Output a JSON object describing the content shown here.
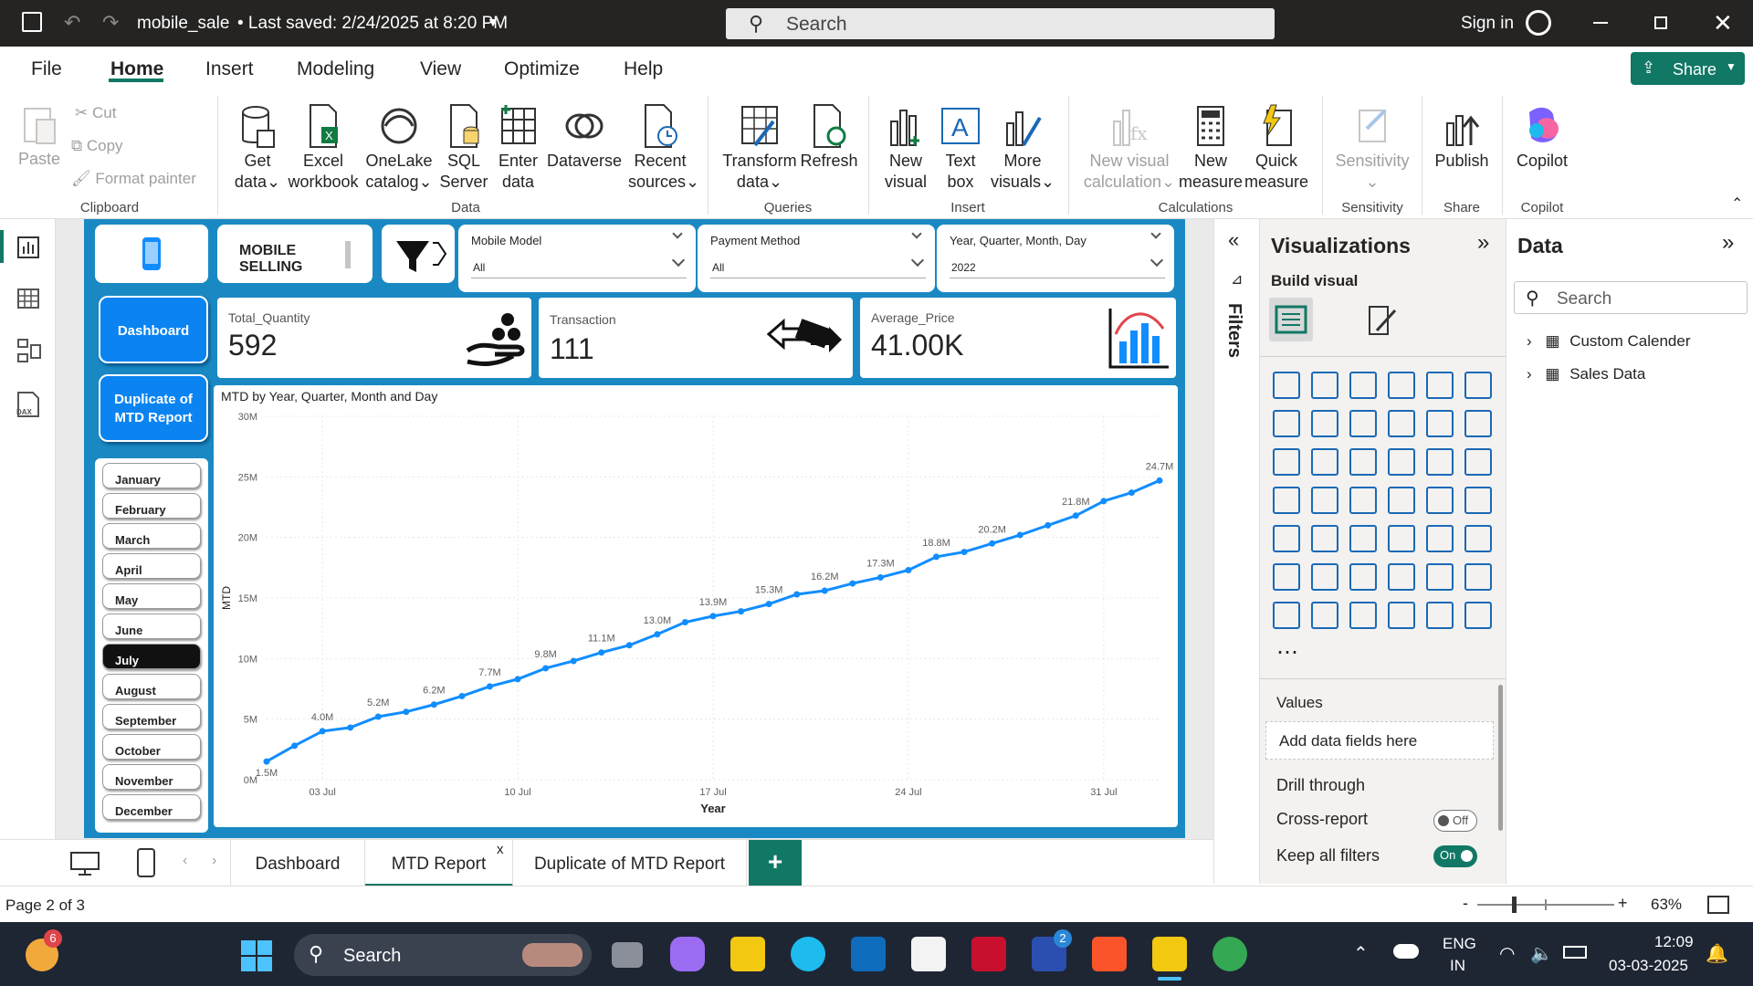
{
  "titlebar": {
    "file_name": "mobile_sale",
    "saved_status": "• Last saved: 2/24/2025 at 8:20 PM",
    "search_placeholder": "Search",
    "sign_in": "Sign in"
  },
  "menu": {
    "items": [
      "File",
      "Home",
      "Insert",
      "Modeling",
      "View",
      "Optimize",
      "Help"
    ],
    "share": "Share"
  },
  "ribbon": {
    "clipboard": {
      "paste": "Paste",
      "cut": "Cut",
      "copy": "Copy",
      "format_painter": "Format painter",
      "group": "Clipboard"
    },
    "data": {
      "get_data": [
        "Get",
        "data"
      ],
      "excel": [
        "Excel",
        "workbook"
      ],
      "onelake": [
        "OneLake",
        "catalog"
      ],
      "sql": [
        "SQL",
        "Server"
      ],
      "enter": [
        "Enter",
        "data"
      ],
      "dataverse": "Dataverse",
      "recent": [
        "Recent",
        "sources"
      ],
      "group": "Data"
    },
    "queries": {
      "transform": [
        "Transform",
        "data"
      ],
      "refresh": "Refresh",
      "group": "Queries"
    },
    "insert": {
      "new_visual": [
        "New",
        "visual"
      ],
      "text_box": [
        "Text",
        "box"
      ],
      "more_visuals": [
        "More",
        "visuals"
      ],
      "group": "Insert"
    },
    "calculations": {
      "new_visual_calc": [
        "New visual",
        "calculation"
      ],
      "new_measure": [
        "New",
        "measure"
      ],
      "quick_measure": [
        "Quick",
        "measure"
      ],
      "group": "Calculations"
    },
    "sensitivity": {
      "label": "Sensitivity",
      "group": "Sensitivity"
    },
    "share": {
      "publish": "Publish",
      "group": "Share"
    },
    "copilot": {
      "label": "Copilot",
      "group": "Copilot"
    }
  },
  "report": {
    "title_card": [
      "MOBILE",
      "SELLING"
    ],
    "slicers": [
      {
        "title": "Mobile Model",
        "value": "All"
      },
      {
        "title": "Payment Method",
        "value": "All"
      },
      {
        "title": "Year, Quarter, Month, Day",
        "value": "2022"
      }
    ],
    "nav_buttons": [
      "Dashboard",
      "Duplicate of MTD Report"
    ],
    "kpis": [
      {
        "label": "Total_Quantity",
        "value": "592"
      },
      {
        "label": "Transaction",
        "value": "111"
      },
      {
        "label": "Average_Price",
        "value": "41.00K"
      }
    ],
    "months": [
      "January",
      "February",
      "March",
      "April",
      "May",
      "June",
      "July",
      "August",
      "September",
      "October",
      "November",
      "December"
    ],
    "selected_month": "July"
  },
  "chart_data": {
    "type": "line",
    "title": "MTD by Year, Quarter, Month and Day",
    "xlabel": "Year",
    "ylabel": "MTD",
    "x_ticks": [
      "03 Jul",
      "10 Jul",
      "17 Jul",
      "24 Jul",
      "31 Jul"
    ],
    "y_ticks": [
      "0M",
      "5M",
      "10M",
      "15M",
      "20M",
      "25M",
      "30M"
    ],
    "ylim": [
      0,
      30
    ],
    "x": [
      1,
      2,
      3,
      4,
      5,
      6,
      7,
      8,
      9,
      10,
      11,
      12,
      13,
      14,
      15,
      16,
      17,
      18,
      19,
      20,
      21,
      22,
      23,
      24,
      25,
      26,
      27,
      28,
      29,
      30,
      31
    ],
    "values": [
      1.5,
      2.8,
      4.0,
      4.3,
      5.2,
      5.6,
      6.2,
      6.9,
      7.7,
      8.3,
      9.2,
      9.8,
      10.5,
      11.1,
      12.0,
      13.0,
      13.5,
      13.9,
      14.5,
      15.3,
      15.6,
      16.2,
      16.7,
      17.3,
      18.4,
      18.8,
      19.5,
      20.2,
      21.0,
      21.8,
      23.0,
      23.7,
      24.7
    ],
    "data_labels": {
      "1": "1.5M",
      "3": "4.0M",
      "5": "5.2M",
      "7": "6.2M",
      "9": "7.7M",
      "11": "9.8M",
      "13": "11.1M",
      "15": "13.0M",
      "17": "13.9M",
      "19": "15.3M",
      "21": "16.2M",
      "23": "17.3M",
      "25": "18.8M",
      "27": "20.2M",
      "29": "21.8M",
      "31": "24.7M"
    },
    "series": [
      {
        "values": [
          1.5,
          2.8,
          4.0,
          4.3,
          5.2,
          5.6,
          6.2,
          6.9,
          7.7,
          8.3,
          9.8,
          10.5,
          11.1,
          12.0,
          13.0,
          13.5,
          13.9,
          14.5,
          15.3,
          15.6,
          16.2,
          16.7,
          17.3,
          18.4,
          18.8,
          19.5,
          20.2,
          21.0,
          21.8,
          23.0,
          23.7,
          24.7
        ]
      }
    ],
    "grid": true,
    "color": "#118dff"
  },
  "filters_label": "Filters",
  "visualizations": {
    "title": "Visualizations",
    "build_visual": "Build visual",
    "values": "Values",
    "add_fields": "Add data fields here",
    "drill_through": "Drill through",
    "cross_report": "Cross-report",
    "cross_report_state": "Off",
    "keep_filters": "Keep all filters",
    "keep_filters_state": "On"
  },
  "data_pane": {
    "title": "Data",
    "search_placeholder": "Search",
    "tables": [
      "Custom Calender",
      "Sales Data"
    ]
  },
  "tabs": {
    "items": [
      "Dashboard",
      "MTD Report",
      "Duplicate of MTD Report"
    ],
    "active": "MTD Report",
    "add": "+"
  },
  "status": {
    "page": "Page 2 of 3",
    "zoom": "63%"
  },
  "taskbar": {
    "search": "Search",
    "lang": [
      "ENG",
      "IN"
    ],
    "time": "12:09",
    "date": "03-03-2025",
    "weather_badge": "6",
    "teams_badge": "2"
  }
}
